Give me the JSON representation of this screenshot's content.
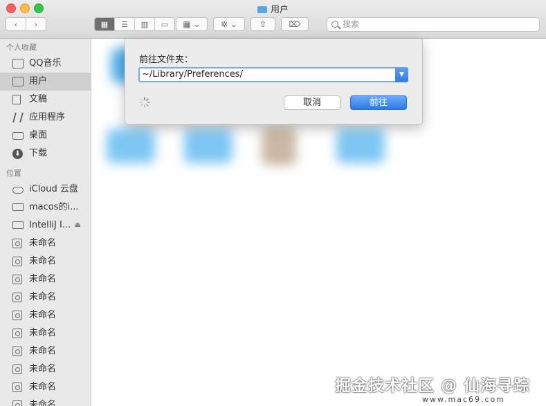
{
  "window": {
    "title": "用户"
  },
  "toolbar": {
    "back_icon": "chevron-left-icon",
    "forward_icon": "chevron-right-icon",
    "views": [
      "icon-view",
      "list-view",
      "column-view",
      "gallery-view"
    ],
    "search_placeholder": "搜索"
  },
  "sidebar": {
    "favorites_header": "个人收藏",
    "favorites": [
      {
        "label": "QQ音乐",
        "icon": "folder-icon"
      },
      {
        "label": "用户",
        "icon": "folder-icon",
        "selected": true
      },
      {
        "label": "文稿",
        "icon": "document-icon"
      },
      {
        "label": "应用程序",
        "icon": "applications-icon"
      },
      {
        "label": "桌面",
        "icon": "desktop-icon"
      },
      {
        "label": "下载",
        "icon": "download-icon"
      }
    ],
    "locations_header": "位置",
    "locations": [
      {
        "label": "iCloud 云盘",
        "icon": "cloud-icon"
      },
      {
        "label": "macos的i...",
        "icon": "computer-icon"
      },
      {
        "label": "IntelliJ I...",
        "icon": "disk-icon",
        "eject": "⏏"
      },
      {
        "label": "未命名",
        "icon": "disk-icon"
      },
      {
        "label": "未命名",
        "icon": "disk-icon"
      },
      {
        "label": "未命名",
        "icon": "disk-icon"
      },
      {
        "label": "未命名",
        "icon": "disk-icon"
      },
      {
        "label": "未命名",
        "icon": "disk-icon"
      },
      {
        "label": "未命名",
        "icon": "disk-icon"
      },
      {
        "label": "未命名",
        "icon": "disk-icon"
      },
      {
        "label": "未命名",
        "icon": "disk-icon"
      },
      {
        "label": "未命名",
        "icon": "disk-icon"
      },
      {
        "label": "未命名",
        "icon": "disk-icon"
      }
    ]
  },
  "dialog": {
    "label": "前往文件夹：",
    "path_value": "~/Library/Preferences/",
    "cancel_label": "取消",
    "go_label": "前往"
  },
  "watermark": {
    "text": "掘金技术社区 @ 仙海寻踪",
    "sub": "www.mac69.com"
  },
  "colors": {
    "accent": "#2c78e8",
    "sidebar_bg": "#e9e9e9",
    "selected_bg": "#cfcfcf"
  }
}
